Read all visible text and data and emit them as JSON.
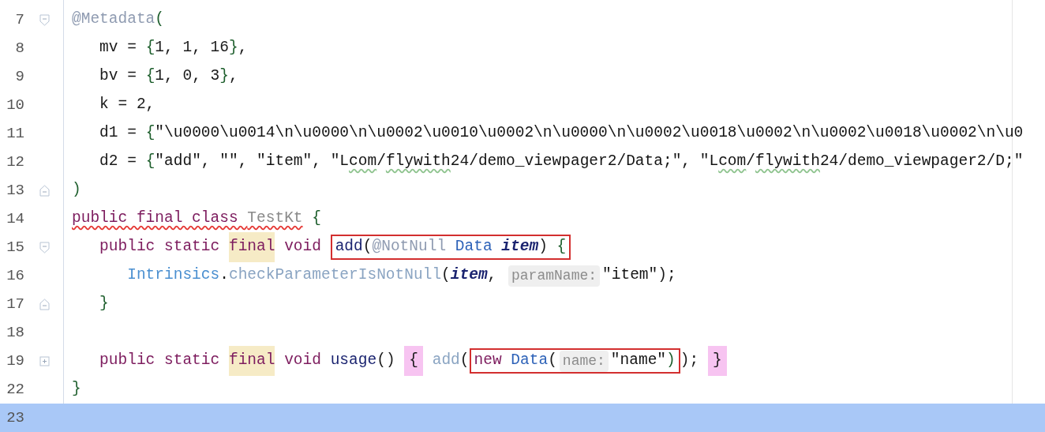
{
  "lines": [
    {
      "number": "7",
      "fold": {
        "kind": "start"
      },
      "current": false,
      "tokens": [
        {
          "text": "@Metadata",
          "kind": "annotation"
        },
        {
          "text": "(",
          "kind": "paren"
        }
      ]
    },
    {
      "number": "8",
      "current": false,
      "tokens": [
        {
          "text": "   mv = ",
          "kind": "plain"
        },
        {
          "text": "{",
          "kind": "paren"
        },
        {
          "text": "1, 1, 16",
          "kind": "plain"
        },
        {
          "text": "}",
          "kind": "paren"
        },
        {
          "text": ",",
          "kind": "plain"
        }
      ]
    },
    {
      "number": "9",
      "current": false,
      "tokens": [
        {
          "text": "   bv = ",
          "kind": "plain"
        },
        {
          "text": "{",
          "kind": "paren"
        },
        {
          "text": "1, 0, 3",
          "kind": "plain"
        },
        {
          "text": "}",
          "kind": "paren"
        },
        {
          "text": ",",
          "kind": "plain"
        }
      ]
    },
    {
      "number": "10",
      "current": false,
      "tokens": [
        {
          "text": "   k = 2,",
          "kind": "plain"
        }
      ]
    },
    {
      "number": "11",
      "current": false,
      "tokens": [
        {
          "text": "   d1 = ",
          "kind": "plain"
        },
        {
          "text": "{",
          "kind": "paren"
        },
        {
          "text": "\"\\u0000\\u0014\\n\\u0000\\n\\u0002\\u0010\\u0002\\n\\u0000\\n\\u0002\\u0018\\u0002\\n\\u0002\\u0018\\u0002\\n\\u0",
          "kind": "string"
        }
      ]
    },
    {
      "number": "12",
      "current": false,
      "tokens": [
        {
          "text": "   d2 = ",
          "kind": "plain"
        },
        {
          "text": "{",
          "kind": "paren"
        },
        {
          "text": "\"add\", \"\", \"item\", \"L",
          "kind": "string"
        },
        {
          "text": "com",
          "kind": "string",
          "typo_underline": true
        },
        {
          "text": "/",
          "kind": "string"
        },
        {
          "text": "flywith",
          "kind": "string",
          "typo_underline": true
        },
        {
          "text": "24/demo_viewpager2/Data;\", \"L",
          "kind": "string"
        },
        {
          "text": "com",
          "kind": "string",
          "typo_underline": true
        },
        {
          "text": "/",
          "kind": "string"
        },
        {
          "text": "flywith",
          "kind": "string",
          "typo_underline": true
        },
        {
          "text": "24/demo_viewpager2/D;\"",
          "kind": "string"
        }
      ]
    },
    {
      "number": "13",
      "fold": {
        "kind": "end"
      },
      "current": false,
      "tokens": [
        {
          "text": ")",
          "kind": "paren"
        }
      ]
    },
    {
      "number": "14",
      "current": false,
      "tokens": [
        {
          "text": "public final class ",
          "kind": "keyword",
          "error_underline": true
        },
        {
          "text": "TestKt",
          "kind": "unused",
          "error_underline": true
        },
        {
          "text": " {",
          "kind": "paren"
        }
      ]
    },
    {
      "number": "15",
      "fold": {
        "kind": "start"
      },
      "current": false,
      "tokens": [
        {
          "text": "   public static ",
          "kind": "keyword"
        },
        {
          "text": "final",
          "kind": "keyword",
          "usage_highlight": true
        },
        {
          "text": " void ",
          "kind": "keyword"
        },
        {
          "kind": "box",
          "children": [
            {
              "text": "add",
              "kind": "method"
            },
            {
              "text": "(",
              "kind": "plain"
            },
            {
              "text": "@NotNull ",
              "kind": "annotation"
            },
            {
              "text": "Data ",
              "kind": "class"
            },
            {
              "text": "item",
              "kind": "param"
            },
            {
              "text": ") ",
              "kind": "plain"
            },
            {
              "text": "{",
              "kind": "paren"
            }
          ]
        }
      ]
    },
    {
      "number": "16",
      "current": false,
      "tokens": [
        {
          "text": "      Intrinsics",
          "kind": "class_ref"
        },
        {
          "text": ".",
          "kind": "plain"
        },
        {
          "text": "checkParameterIsNotNull",
          "kind": "static_call"
        },
        {
          "text": "(",
          "kind": "plain"
        },
        {
          "text": "item",
          "kind": "param"
        },
        {
          "text": ", ",
          "kind": "plain"
        },
        {
          "text": "paramName:",
          "kind": "hint"
        },
        {
          "text": "\"item\"",
          "kind": "string"
        },
        {
          "text": ");",
          "kind": "plain"
        }
      ]
    },
    {
      "number": "17",
      "fold": {
        "kind": "end"
      },
      "current": false,
      "tokens": [
        {
          "text": "   }",
          "kind": "paren"
        }
      ]
    },
    {
      "number": "18",
      "current": false
    },
    {
      "number": "19",
      "fold": {
        "kind": "collapsed"
      },
      "current": false,
      "tokens": [
        {
          "text": "   public static ",
          "kind": "keyword"
        },
        {
          "text": "final",
          "kind": "keyword",
          "usage_highlight": true
        },
        {
          "text": " void ",
          "kind": "keyword"
        },
        {
          "text": "usage",
          "kind": "method"
        },
        {
          "text": "() ",
          "kind": "plain"
        },
        {
          "text": "{",
          "kind": "plain",
          "match_highlight": true
        },
        {
          "text": " add",
          "kind": "static_call"
        },
        {
          "text": "(",
          "kind": "plain"
        },
        {
          "kind": "box",
          "children": [
            {
              "text": "new ",
              "kind": "keyword"
            },
            {
              "text": "Data",
              "kind": "class"
            },
            {
              "text": "(",
              "kind": "plain"
            },
            {
              "text": "name:",
              "kind": "hint"
            },
            {
              "text": "\"name\"",
              "kind": "string"
            },
            {
              "text": ")",
              "kind": "paren"
            }
          ]
        },
        {
          "text": "); ",
          "kind": "plain"
        },
        {
          "text": "}",
          "kind": "plain",
          "match_highlight": true
        }
      ]
    },
    {
      "number": "22",
      "current": false,
      "tokens": [
        {
          "text": "}",
          "kind": "paren"
        }
      ]
    },
    {
      "number": "23",
      "current": true
    }
  ]
}
